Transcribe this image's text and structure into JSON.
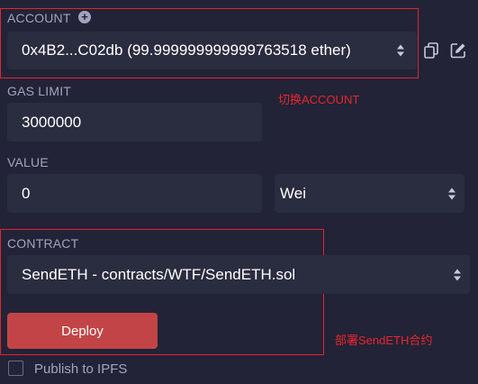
{
  "account": {
    "label": "ACCOUNT",
    "value": "0x4B2...C02db (99.999999999999763518 ether)",
    "add_icon": "plus-circle-icon",
    "copy_icon": "copy-icon",
    "edit_icon": "edit-icon"
  },
  "gas_limit": {
    "label": "GAS LIMIT",
    "value": "3000000"
  },
  "value": {
    "label": "VALUE",
    "amount": "0",
    "unit": "Wei"
  },
  "contract": {
    "label": "CONTRACT",
    "value": "SendETH - contracts/WTF/SendETH.sol"
  },
  "deploy": {
    "label": "Deploy"
  },
  "publish": {
    "label": "Publish to IPFS",
    "checked": false
  },
  "annotations": {
    "switch_account": "切换ACCOUNT",
    "deploy_contract": "部署SendETH合约",
    "color": "#e0242f"
  }
}
